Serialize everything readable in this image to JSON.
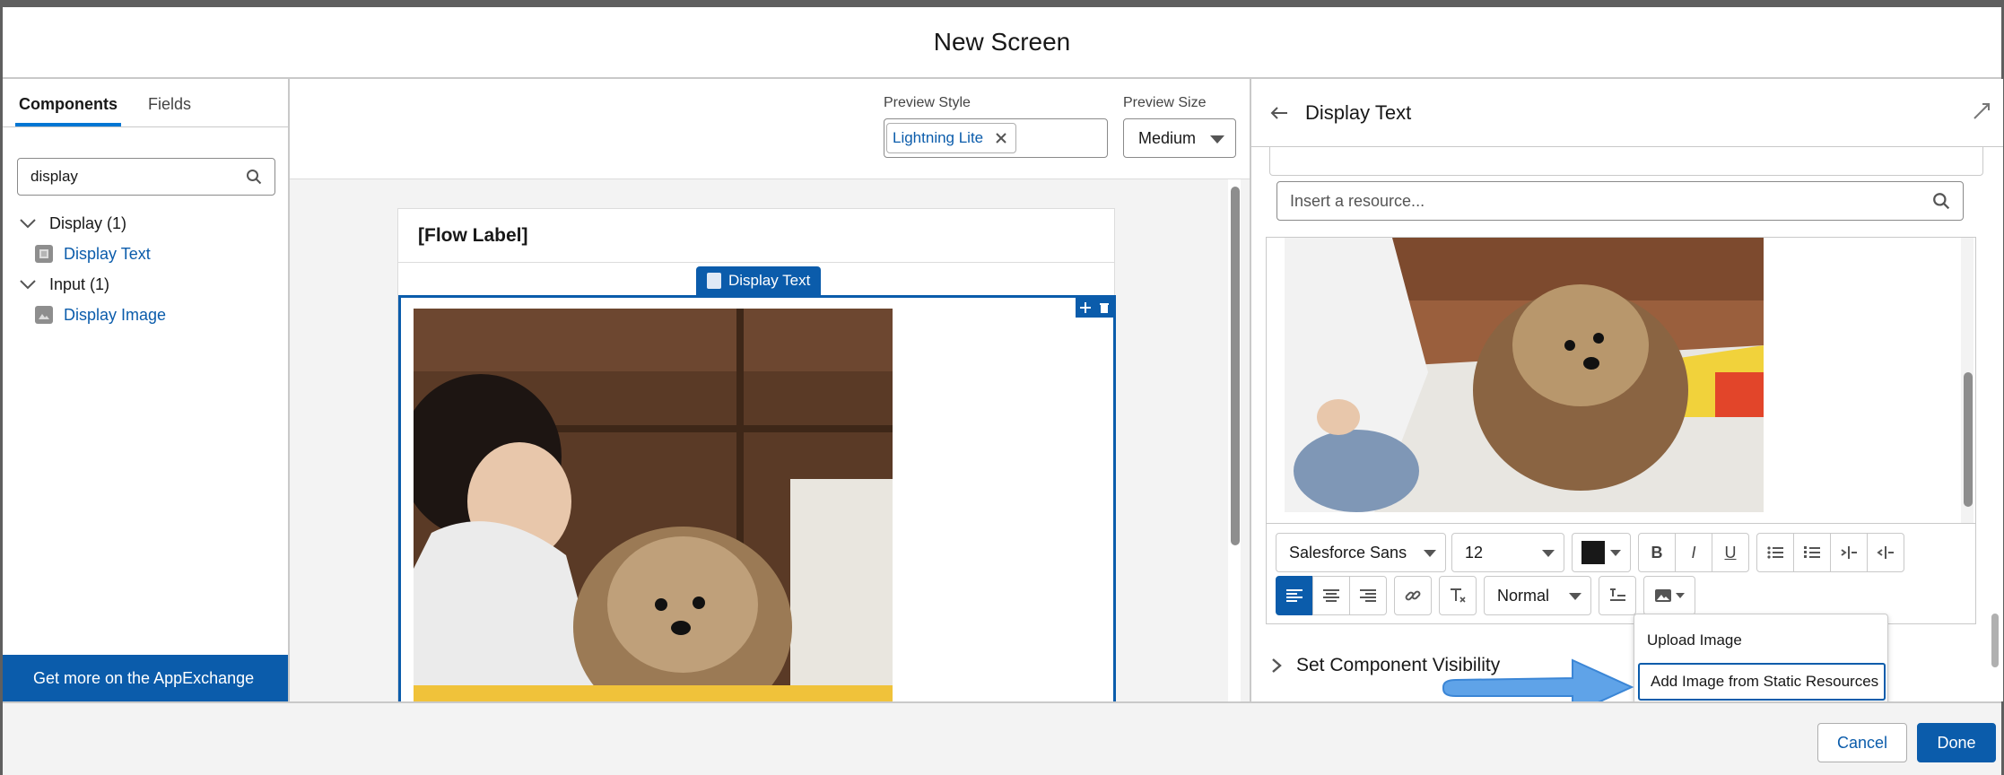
{
  "modal": {
    "title": "New Screen"
  },
  "left_panel": {
    "tabs": [
      {
        "label": "Components"
      },
      {
        "label": "Fields"
      }
    ],
    "search": {
      "value": "display"
    },
    "tree": {
      "groups": [
        {
          "label": "Display (1)",
          "items": [
            {
              "label": "Display Text",
              "icon": "rich-text-icon"
            }
          ]
        },
        {
          "label": "Input (1)",
          "items": [
            {
              "label": "Display Image",
              "icon": "image-icon"
            }
          ]
        }
      ]
    },
    "appexchange_label": "Get more on the AppExchange"
  },
  "center": {
    "preview_style": {
      "label": "Preview Style",
      "pill": "Lightning Lite"
    },
    "preview_size": {
      "label": "Preview Size",
      "value": "Medium"
    },
    "canvas": {
      "flow_label": "[Flow Label]",
      "component_tag": "Display Text"
    }
  },
  "right_panel": {
    "title": "Display Text",
    "insert_resource": {
      "placeholder": "Insert a resource..."
    },
    "toolbar": {
      "font_family": "Salesforce Sans",
      "font_size": "12",
      "text_color": "#181818",
      "format": "Normal"
    },
    "image_menu": {
      "items": [
        {
          "label": "Upload Image"
        },
        {
          "label": "Add Image from Static Resources"
        }
      ]
    },
    "visibility_section": "Set Component Visibility"
  },
  "footer": {
    "cancel_label": "Cancel",
    "done_label": "Done"
  },
  "colors": {
    "brand": "#0b5cab",
    "accent_arrow": "#5fa3e8"
  }
}
